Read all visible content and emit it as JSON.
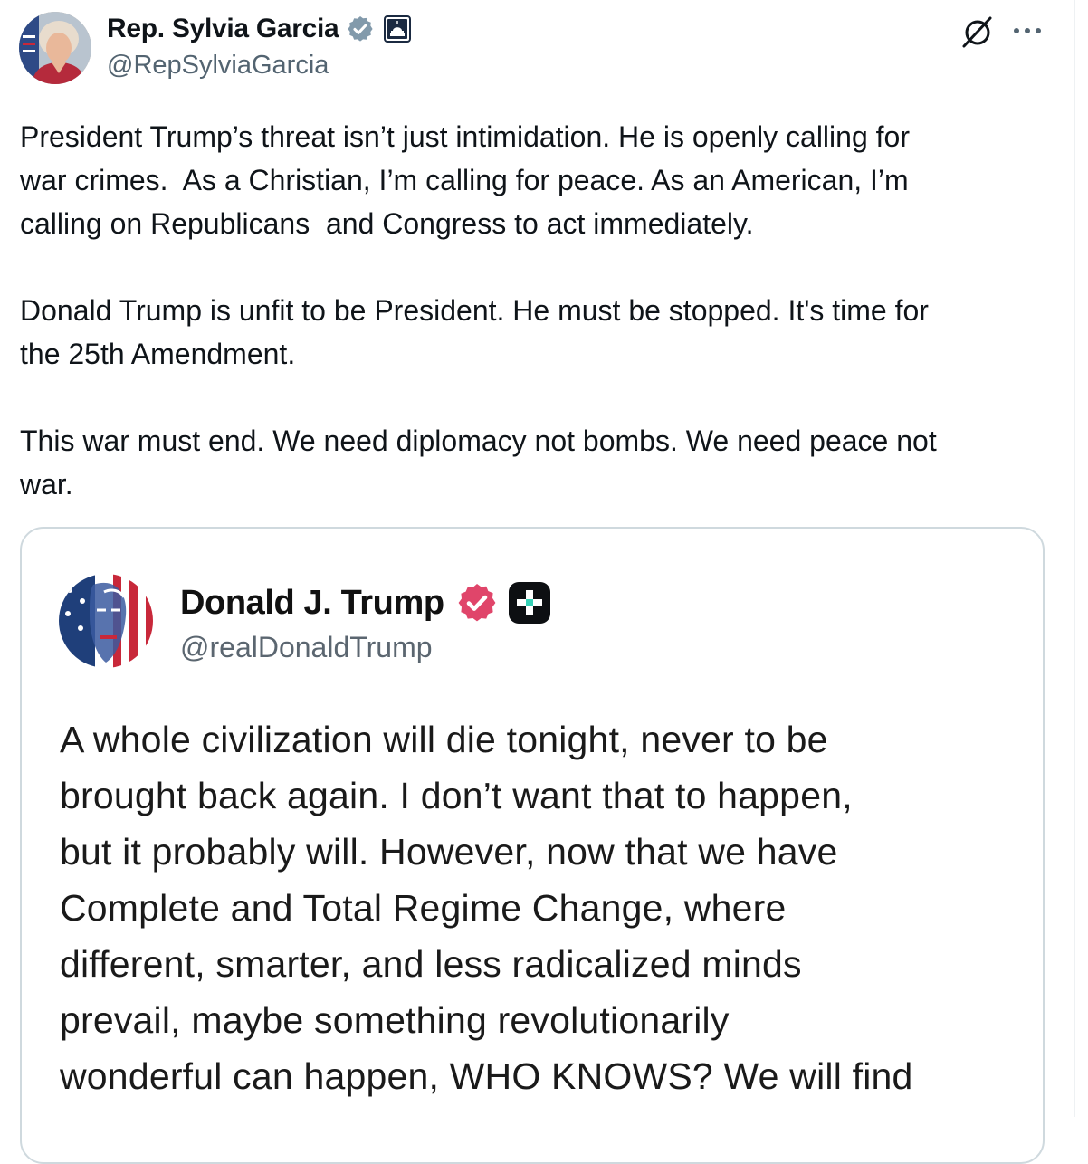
{
  "post": {
    "author": {
      "display_name": "Rep. Sylvia Garcia",
      "handle": "@RepSylviaGarcia",
      "verification": "gray-government-badge",
      "affiliate_badge": "us-capitol-icon"
    },
    "actions": {
      "grok_icon": "slashed-circle-icon",
      "more_icon": "ellipsis-icon"
    },
    "text_paragraphs": [
      "President Trump’s threat isn’t just intimidation. He is openly calling for\nwar crimes.  As a Christian, I’m calling for peace. As an American, I’m\ncalling on Republicans  and Congress to act immediately.",
      "Donald Trump is unfit to be President. He must be stopped. It's time for\nthe 25th Amendment.",
      "This war must end. We need diplomacy not bombs. We need peace not\nwar."
    ]
  },
  "quoted_post": {
    "author": {
      "display_name": "Donald J. Trump",
      "handle": "@realDonaldTrump",
      "verification": "red-verified-badge",
      "plus_badge": "plus-icon"
    },
    "text_lines": [
      "A whole civilization will die tonight, never to be",
      "brought back again. I don’t want that to happen,",
      "but it probably will. However, now that we have",
      "Complete and Total Regime Change, where",
      "different, smarter, and less radicalized minds",
      "prevail, maybe something revolutionarily",
      "wonderful can happen, WHO KNOWS? We will find"
    ]
  },
  "colors": {
    "text_primary": "#0f1419",
    "text_secondary": "#536471",
    "card_border": "#cfd9de",
    "gray_badge": "#829aab",
    "truth_verified": "#e0456a"
  }
}
